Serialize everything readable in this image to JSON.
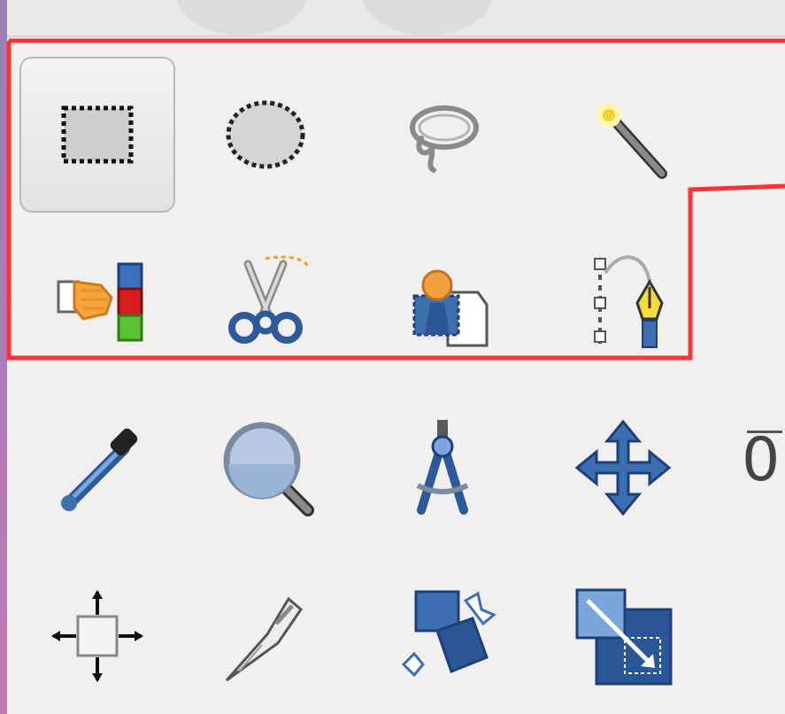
{
  "toolbox": {
    "rows": [
      [
        "rect-select",
        "ellipse-select",
        "free-select",
        "fuzzy-select"
      ],
      [
        "select-by-color",
        "scissors-select",
        "foreground-select",
        "paths"
      ],
      [
        "color-picker",
        "zoom",
        "measure",
        "move"
      ],
      [
        "align",
        "crop",
        "unified-transform",
        "scale"
      ]
    ],
    "active_tool": "rect-select",
    "cut_off_label": "0"
  },
  "highlight": {
    "color": "#ff3333",
    "covers_rows": [
      1,
      2
    ]
  },
  "colors": {
    "background": "#f1f0ef",
    "tool_blue": "#3d6fb0",
    "tool_dark_blue": "#23457a"
  }
}
